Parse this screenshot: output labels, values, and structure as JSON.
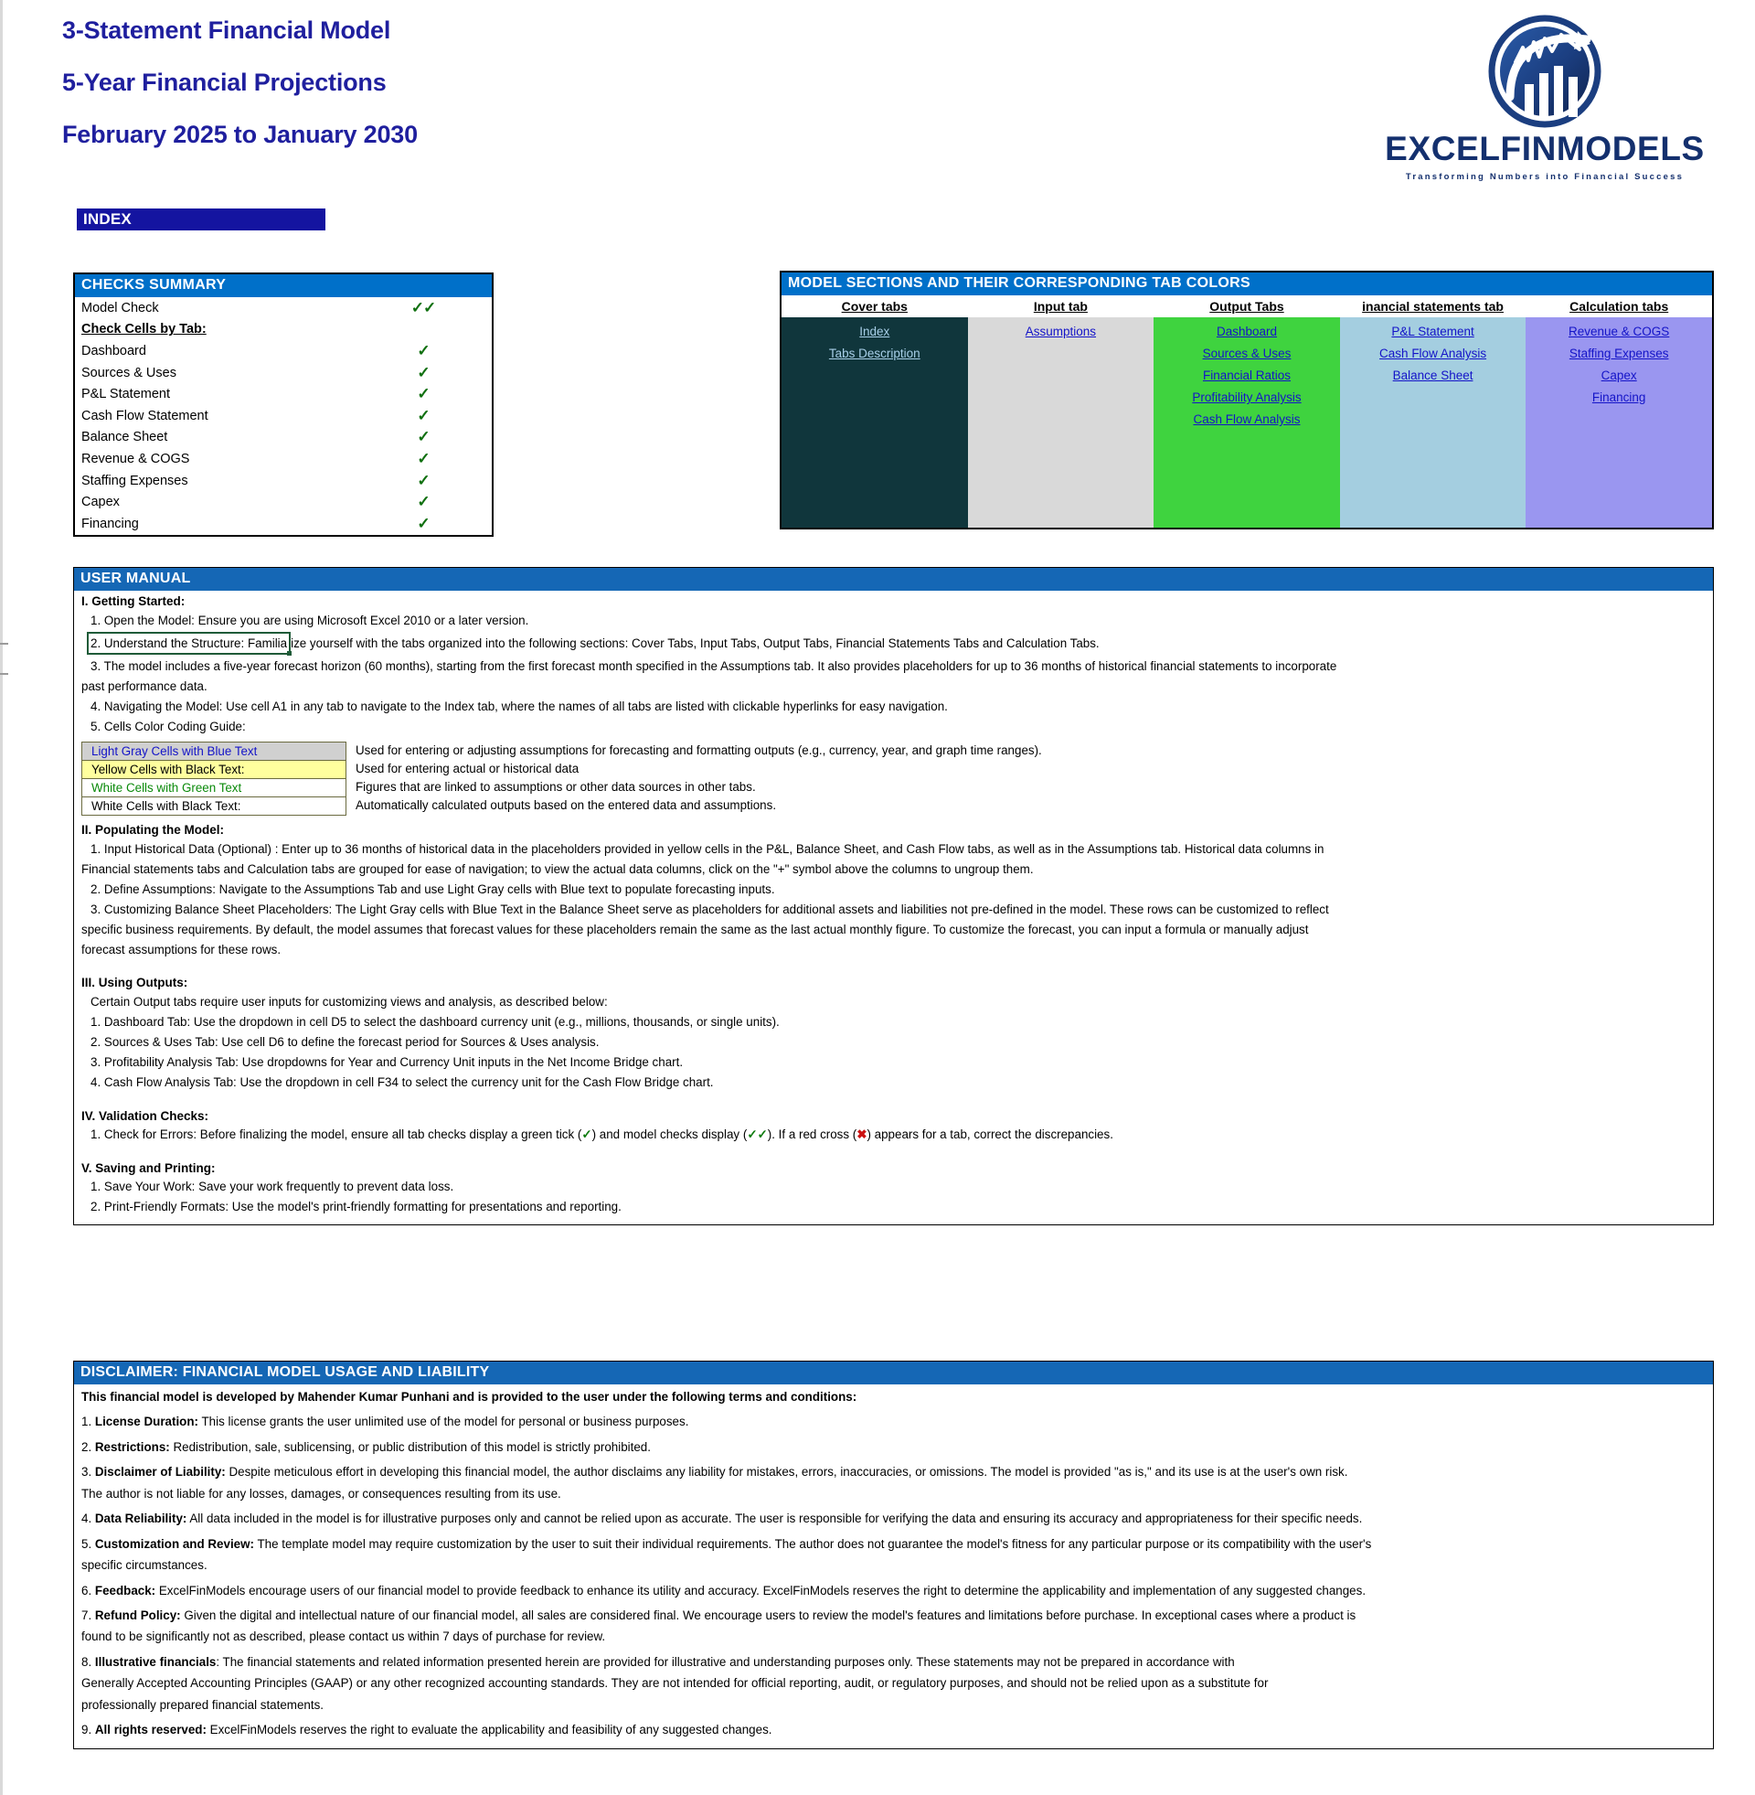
{
  "header": {
    "title_lines": [
      "3-Statement Financial Model",
      "5-Year Financial Projections",
      "February 2025 to January 2030"
    ],
    "index_badge": "INDEX",
    "brand": {
      "name": "EXCELFINMODELS",
      "tagline": "Transforming Numbers into Financial Success",
      "color": "#14306e"
    }
  },
  "checks": {
    "panel_title": "CHECKS  SUMMARY",
    "model_check": {
      "label": "Model Check",
      "mark": "✓✓"
    },
    "sub_heading": "Check Cells by Tab:",
    "rows": [
      {
        "label": "Dashboard",
        "mark": "✓"
      },
      {
        "label": "Sources & Uses",
        "mark": "✓"
      },
      {
        "label": "P&L Statement",
        "mark": "✓"
      },
      {
        "label": "Cash Flow Statement",
        "mark": "✓"
      },
      {
        "label": "Balance Sheet",
        "mark": "✓"
      },
      {
        "label": "Revenue & COGS",
        "mark": "✓"
      },
      {
        "label": "Staffing Expenses",
        "mark": "✓"
      },
      {
        "label": "Capex",
        "mark": "✓"
      },
      {
        "label": "Financing",
        "mark": "✓"
      }
    ]
  },
  "sections": {
    "panel_title": "MODEL SECTIONS AND THEIR CORRESPONDING TAB COLORS",
    "columns": [
      {
        "header": "Cover tabs",
        "color": "#10363c",
        "links": [
          "Index",
          "Tabs Description"
        ]
      },
      {
        "header": "Input tab",
        "color": "#d9d9d9",
        "links": [
          "Assumptions "
        ]
      },
      {
        "header": "Output Tabs",
        "color": "#3fd33f",
        "links": [
          "Dashboard",
          "Sources & Uses",
          "Financial Ratios ",
          "Profitability Analysis",
          "Cash Flow Analysis"
        ]
      },
      {
        "header": "inancial statements tab",
        "color": "#a4cee0",
        "links": [
          "P&L Statement",
          "Cash Flow Analysis",
          "Balance Sheet"
        ]
      },
      {
        "header": "Calculation tabs",
        "color": "#9a96f0",
        "links": [
          "Revenue & COGS",
          "Staffing Expenses",
          "Capex ",
          "Financing"
        ]
      }
    ]
  },
  "manual": {
    "panel_title": "USER MANUAL",
    "section_1": {
      "heading": "I. Getting Started:",
      "items": [
        "1. Open the Model: Ensure you are using Microsoft Excel 2010 or a later version.",
        "2. Understand the Structure: Familiarize yourself with the tabs organized into the following sections: Cover Tabs, Input Tabs, Output Tabs, Financial Statements Tabs and  Calculation Tabs.",
        "3. The model includes a five-year forecast horizon (60 months), starting from the first forecast month specified in the Assumptions tab. It also provides placeholders for up to 36 months of historical financial statements to incorporate",
        "past performance data.",
        "4. Navigating the Model: Use cell A1 in any tab to navigate to the Index tab, where the names of all tabs are listed with clickable hyperlinks for easy navigation.",
        "5. Cells Color Coding Guide:"
      ],
      "cursor_item_text_before": "2. Understand the Structure: Familia",
      "cursor_item_text_after": "ize yourself with the tabs organized into the following sections: Cover Tabs, Input Tabs, Output Tabs, Financial Statements Tabs and  Calculation Tabs."
    },
    "color_guide": [
      {
        "swatch": "Light Gray Cells with Blue Text",
        "desc": "Used for entering or adjusting assumptions for forecasting and formatting outputs (e.g., currency, year, and graph time ranges)."
      },
      {
        "swatch": "Yellow Cells with Black Text:",
        "desc": "Used for entering actual or historical data"
      },
      {
        "swatch": "White Cells with Green Text",
        "desc": "Figures that are linked to assumptions or other data sources in other tabs."
      },
      {
        "swatch": "White Cells with Black Text:",
        "desc": "Automatically calculated outputs based on the entered data and assumptions."
      }
    ],
    "section_2": {
      "heading": "II. Populating the Model:",
      "items": [
        "1. Input Historical Data (Optional) : Enter up to 36 months of historical data in the placeholders provided in yellow cells in the P&L, Balance Sheet, and Cash Flow tabs, as well as in the Assumptions tab. Historical data columns in",
        "Financial statements tabs and Calculation tabs are grouped for ease of navigation; to view the actual data columns, click on the \"+\" symbol above the columns to ungroup them.",
        "2. Define Assumptions: Navigate to the Assumptions Tab and use Light Gray cells with Blue text to populate forecasting inputs.",
        "3. Customizing Balance Sheet Placeholders: The Light Gray cells with Blue Text in the Balance Sheet serve as placeholders for additional assets and liabilities not pre-defined in the model. These rows can be customized to reflect",
        "specific business requirements. By default, the model assumes that forecast values for these placeholders remain the same as the last actual monthly figure. To customize the forecast, you can input a formula or manually adjust",
        "forecast assumptions for these rows."
      ]
    },
    "section_3": {
      "heading": "III. Using Outputs:",
      "items": [
        "Certain Output tabs require user inputs for customizing views and analysis, as described below:",
        "1. Dashboard Tab: Use the dropdown in cell D5 to select the dashboard currency unit (e.g., millions, thousands, or single units).",
        "2. Sources & Uses Tab: Use cell D6 to define the forecast period for Sources & Uses analysis.",
        "3. Profitability Analysis Tab: Use dropdowns for Year and Currency Unit inputs in the Net Income Bridge chart.",
        "4. Cash Flow Analysis Tab: Use the dropdown in cell F34 to select the currency unit for the Cash Flow Bridge chart."
      ]
    },
    "section_4": {
      "heading": "IV. Validation Checks:",
      "item_prefix": "1. Check for Errors:  Before finalizing the model, ensure all tab checks display a green tick (",
      "tick_single": "✓",
      "item_middle": ") and model checks display  (",
      "tick_double": "✓✓",
      "item_middle_2": "). If a red cross (",
      "cross": "✖",
      "item_suffix": ") appears for a tab, correct the discrepancies."
    },
    "section_5": {
      "heading": "V. Saving and Printing:",
      "items": [
        "1. Save Your Work: Save your work frequently to prevent data loss.",
        "2. Print-Friendly Formats: Use the model's print-friendly formatting for presentations and reporting."
      ]
    }
  },
  "disclaimer": {
    "panel_title": "DISCLAIMER: FINANCIAL MODEL USAGE AND LIABILITY",
    "intro": "This financial model  is developed by Mahender Kumar Punhani and is provided to the user under the following terms and conditions:",
    "items": [
      {
        "num": "1. ",
        "bold": "License Duration:",
        "text": " This license grants the user unlimited use of the model for personal or business purposes.",
        "cont": ""
      },
      {
        "num": "2. ",
        "bold": "Restrictions:",
        "text": " Redistribution, sale, sublicensing, or public distribution of this model is strictly prohibited.",
        "cont": ""
      },
      {
        "num": "3. ",
        "bold": "Disclaimer of Liability:",
        "text": " Despite meticulous effort in developing this financial model, the author disclaims any liability for mistakes, errors, inaccuracies, or omissions. The model is provided \"as is,\" and its use is at the user's own risk.",
        "cont": "The author is not liable for  any losses, damages, or consequences resulting from its use."
      },
      {
        "num": "4. ",
        "bold": "Data Reliability:",
        "text": " All data included in the model is for illustrative purposes only and cannot be relied upon as accurate. The user is  responsible for verifying the data and ensuring its accuracy and appropriateness for their specific needs.",
        "cont": ""
      },
      {
        "num": "5. ",
        "bold": "Customization and Review:",
        "text": " The template model may require customization by the user to suit their individual requirements. The author does not guarantee the model's fitness for any  particular purpose or its compatibility with the user's",
        "cont": "specific circumstances."
      },
      {
        "num": "6. ",
        "bold": "Feedback:",
        "text": " ExcelFinModels encourage users of our financial model to provide feedback to enhance its utility and accuracy. ExcelFinModels reserves the right to determine the applicability and implementation of any suggested changes.",
        "cont": ""
      },
      {
        "num": "7. ",
        "bold": "Refund Policy:",
        "text": " Given the digital and intellectual nature of our financial model, all sales are considered final. We encourage users to review the model's features and limitations before purchase. In exceptional cases where a product is",
        "cont": "found to be  significantly not as described, please contact us within 7 days of purchase for review."
      },
      {
        "num": "8. ",
        "bold": "Illustrative financials",
        "text": ": The financial statements and related information presented herein are provided for illustrative and understanding purposes only. These statements may not be prepared in accordance with",
        "cont": "Generally Accepted Accounting Principles (GAAP)  or any other  recognized accounting standards. They are not intended for official reporting, audit, or regulatory purposes, and should not be relied upon as a substitute for",
        "cont2": "professionally prepared financial statements."
      },
      {
        "num": "9. ",
        "bold": "All rights reserved:",
        "text": " ExcelFinModels reserves the right to evaluate the applicability and feasibility of any suggested changes.",
        "cont": ""
      }
    ]
  }
}
